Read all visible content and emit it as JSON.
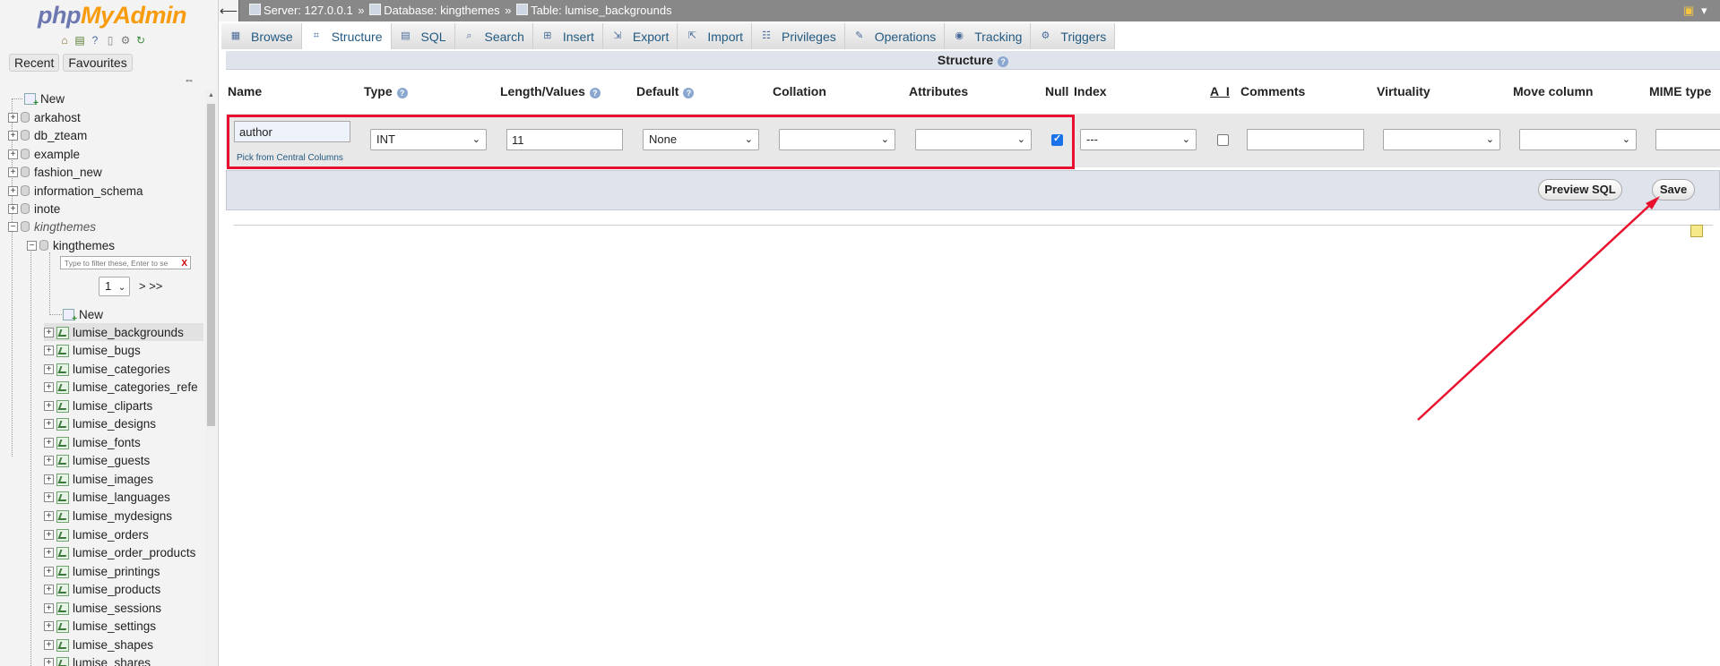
{
  "logo": {
    "php": "php",
    "myadmin": "MyAdmin"
  },
  "nav_tabs": {
    "recent": "Recent",
    "favourites": "Favourites"
  },
  "tree": {
    "new_top": "New",
    "databases": [
      "arkahost",
      "db_zteam",
      "example",
      "fashion_new",
      "information_schema",
      "inote",
      "kingthemes"
    ],
    "child_db": "kingthemes",
    "filter_placeholder": "Type to filter these, Enter to se",
    "filter_clear": "X",
    "page_value": "1",
    "page_next": "> >>",
    "new_table": "New",
    "tables": [
      "lumise_backgrounds",
      "lumise_bugs",
      "lumise_categories",
      "lumise_categories_refe",
      "lumise_cliparts",
      "lumise_designs",
      "lumise_fonts",
      "lumise_guests",
      "lumise_images",
      "lumise_languages",
      "lumise_mydesigns",
      "lumise_orders",
      "lumise_order_products",
      "lumise_printings",
      "lumise_products",
      "lumise_sessions",
      "lumise_settings",
      "lumise_shapes",
      "lumise_shares"
    ],
    "selected_table": "lumise_backgrounds"
  },
  "breadcrumb": {
    "server": "Server: 127.0.0.1",
    "database": "Database: kingthemes",
    "table": "Table: lumise_backgrounds",
    "separator": "»"
  },
  "main_tabs": [
    {
      "label": "Browse",
      "icon": "browse-icon"
    },
    {
      "label": "Structure",
      "icon": "structure-icon",
      "active": true
    },
    {
      "label": "SQL",
      "icon": "sql-icon"
    },
    {
      "label": "Search",
      "icon": "search-icon"
    },
    {
      "label": "Insert",
      "icon": "insert-icon"
    },
    {
      "label": "Export",
      "icon": "export-icon"
    },
    {
      "label": "Import",
      "icon": "import-icon"
    },
    {
      "label": "Privileges",
      "icon": "privileges-icon"
    },
    {
      "label": "Operations",
      "icon": "operations-icon"
    },
    {
      "label": "Tracking",
      "icon": "tracking-icon"
    },
    {
      "label": "Triggers",
      "icon": "triggers-icon"
    }
  ],
  "structure_title": "Structure",
  "columns": {
    "name": "Name",
    "type": "Type",
    "length": "Length/Values",
    "default": "Default",
    "collation": "Collation",
    "attributes": "Attributes",
    "null": "Null",
    "index": "Index",
    "ai": "A_I",
    "comments": "Comments",
    "virtuality": "Virtuality",
    "move_column": "Move column",
    "mime_type": "MIME type"
  },
  "row": {
    "name_value": "author",
    "pick_link": "Pick from Central Columns",
    "type_value": "INT",
    "length_value": "11",
    "default_value": "None",
    "collation_value": "",
    "attributes_value": "",
    "null_checked": true,
    "index_value": "---",
    "ai_checked": false,
    "comments_value": "",
    "virtuality_value": "",
    "move_column_value": ""
  },
  "buttons": {
    "preview_sql": "Preview SQL",
    "save": "Save"
  },
  "annotation_color": "#e8102e"
}
